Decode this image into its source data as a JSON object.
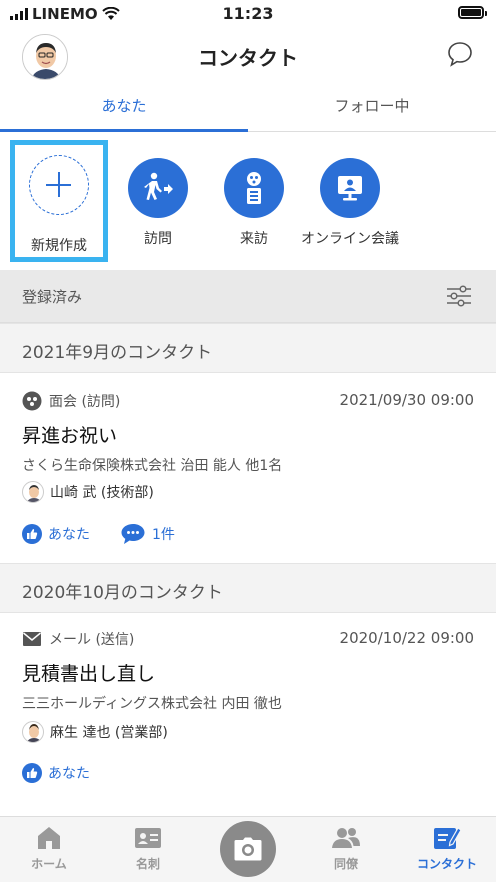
{
  "status_bar": {
    "carrier": "LINEMO",
    "time": "11:23"
  },
  "header": {
    "title": "コンタクト"
  },
  "tabs": [
    {
      "label": "あなた",
      "active": true
    },
    {
      "label": "フォロー中",
      "active": false
    }
  ],
  "actions": [
    {
      "label": "新規作成",
      "icon": "plus-icon"
    },
    {
      "label": "訪問",
      "icon": "walk-icon"
    },
    {
      "label": "来訪",
      "icon": "visitor-icon"
    },
    {
      "label": "オンライン会議",
      "icon": "online-meeting-icon"
    }
  ],
  "registered": {
    "label": "登録済み"
  },
  "sections": [
    {
      "month": "2021年9月のコンタクト",
      "type": "面会 (訪問)",
      "date": "2021/09/30 09:00",
      "title": "昇進お祝い",
      "org": "さくら生命保険株式会社 治田 能人 他1名",
      "person": "山崎 武 (技術部)",
      "like": "あなた",
      "comments": "1件"
    },
    {
      "month": "2020年10月のコンタクト",
      "type": "メール (送信)",
      "date": "2020/10/22 09:00",
      "title": "見積書出し直し",
      "org": "三三ホールディングス株式会社 内田 徹也",
      "person": "麻生 達也 (営業部)",
      "like": "あなた"
    }
  ],
  "bottom_nav": [
    {
      "label": "ホーム",
      "icon": "home-icon"
    },
    {
      "label": "名刺",
      "icon": "business-card-icon"
    },
    {
      "label": "",
      "icon": "camera-icon"
    },
    {
      "label": "同僚",
      "icon": "colleagues-icon"
    },
    {
      "label": "コンタクト",
      "icon": "contact-icon",
      "active": true
    }
  ],
  "colors": {
    "accent": "#2b6fd6",
    "highlight": "#3ab3f0"
  }
}
